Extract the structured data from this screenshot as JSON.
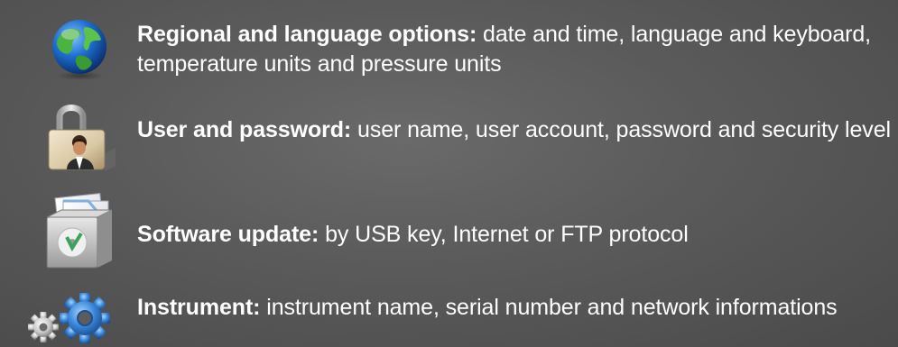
{
  "items": [
    {
      "icon": "globe-icon",
      "title": "Regional and language options:",
      "description": "date and time, language and keyboard, temperature units and pressure units"
    },
    {
      "icon": "padlock-user-icon",
      "title": "User and password:",
      "description": "user name, user account, password and security level"
    },
    {
      "icon": "software-update-icon",
      "title": "Software update:",
      "description": "by USB key, Internet or FTP protocol"
    },
    {
      "icon": "gears-icon",
      "title": "Instrument:",
      "description": "instrument name, serial number and network informations"
    }
  ],
  "colors": {
    "text": "#ffffff",
    "background": "#5c5c5c",
    "globe_land": "#3fa83c",
    "globe_sea": "#1e6fd1",
    "gear_blue": "#3a86d8"
  }
}
